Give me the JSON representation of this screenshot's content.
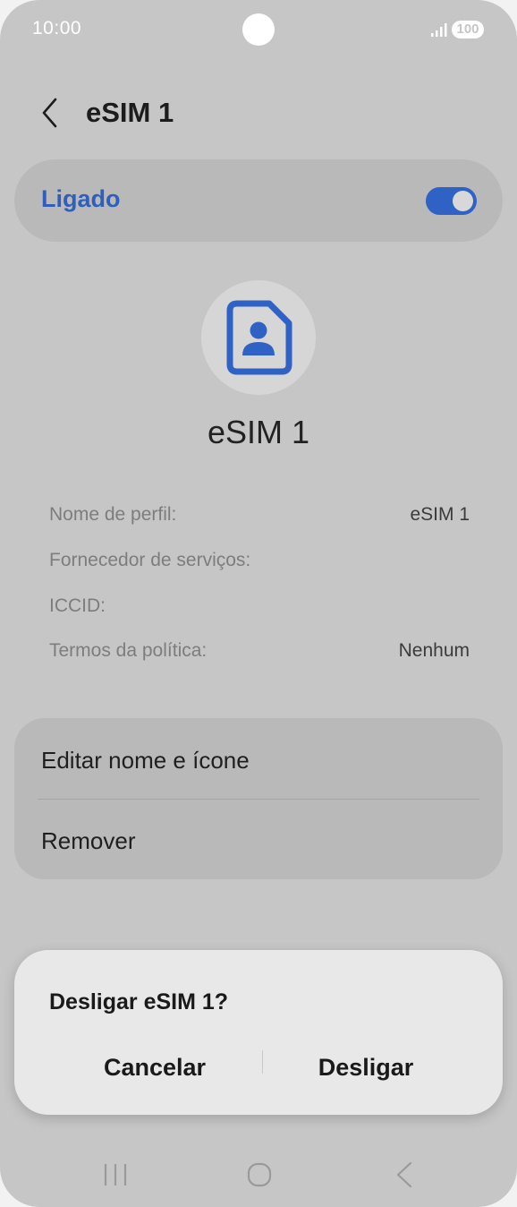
{
  "status_bar": {
    "time": "10:00",
    "battery": "100",
    "icons": [
      "camera-cutout",
      "signal-icon",
      "battery-icon"
    ]
  },
  "header": {
    "title": "eSIM 1",
    "back_icon": "chevron-left-icon"
  },
  "toggle": {
    "label": "Ligado",
    "state": true,
    "accent_color": "#2f62c4"
  },
  "profile": {
    "icon": "sim-card-person-icon",
    "name": "eSIM 1"
  },
  "info": [
    {
      "label": "Nome de perfil:",
      "value": "eSIM 1"
    },
    {
      "label": "Fornecedor de serviços:",
      "value": ""
    },
    {
      "label": "ICCID:",
      "value": ""
    },
    {
      "label": "Termos da política:",
      "value": "Nenhum"
    }
  ],
  "actions": {
    "edit": "Editar nome e ícone",
    "remove": "Remover"
  },
  "dialog": {
    "title": "Desligar eSIM 1?",
    "cancel": "Cancelar",
    "confirm": "Desligar"
  },
  "navbar": {
    "icons": [
      "recent-apps-icon",
      "home-icon",
      "back-icon"
    ]
  }
}
